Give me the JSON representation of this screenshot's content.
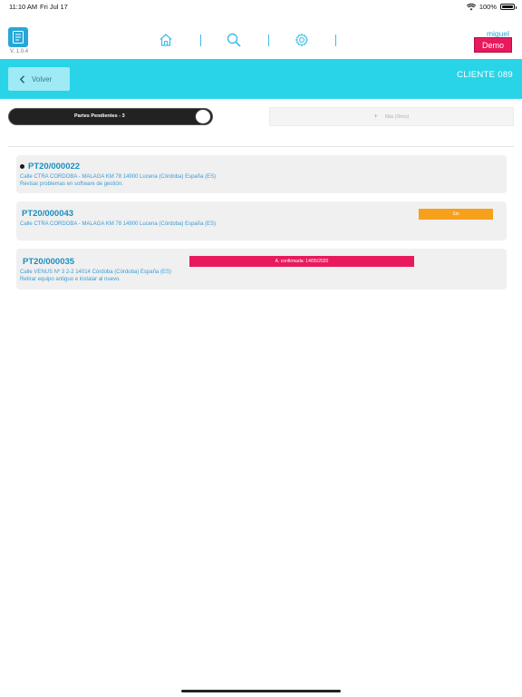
{
  "status_bar": {
    "time": "11:10 AM",
    "date": "Fri Jul 17",
    "battery": "100%",
    "battery_level": 1.0
  },
  "app": {
    "version": "V. 1.0.4",
    "user_name": "miguel",
    "demo_label": "Demo",
    "nav_icons": [
      "home-icon",
      "search-icon",
      "gear-icon"
    ],
    "colors": {
      "accent": "#27a7d8",
      "header": "#2ad4e8",
      "demo": "#e8195c",
      "warning": "#f7a01c"
    }
  },
  "header": {
    "back_label": "Volver",
    "client_label": "CLIENTE 089"
  },
  "filters": {
    "toggle_label": "Partes Pendientes - 3",
    "toggle_on": true,
    "more_label": "Más (Otros)",
    "more_icon": "plus-icon"
  },
  "parts": [
    {
      "id": "PT20/000022",
      "address": "Calle CTRA CORDOBA - MALAGA KM 78 14900 Lucena (Córdoba) España (ES)",
      "description": "Revisar problemas en software de gestión.",
      "has_dot": true,
      "badge": null
    },
    {
      "id": "PT20/000043",
      "address": "Calle CTRA CORDOBA - MALAGA KM 78 14900 Lucena (Córdoba) España (ES)",
      "description": "",
      "has_dot": false,
      "badge": {
        "label": "Sin",
        "color": "#f7a01c"
      }
    },
    {
      "id": "PT20/000035",
      "address": "Calle VENUS Nº 3 2-2 14014 Córdoba (Córdoba) España (ES)",
      "description": "Retirar equipo antiguo e instalar al nuevo.",
      "has_dot": false,
      "badge": {
        "label": "A. confirmada: 14/05/2020",
        "color": "#e8195c"
      }
    }
  ]
}
